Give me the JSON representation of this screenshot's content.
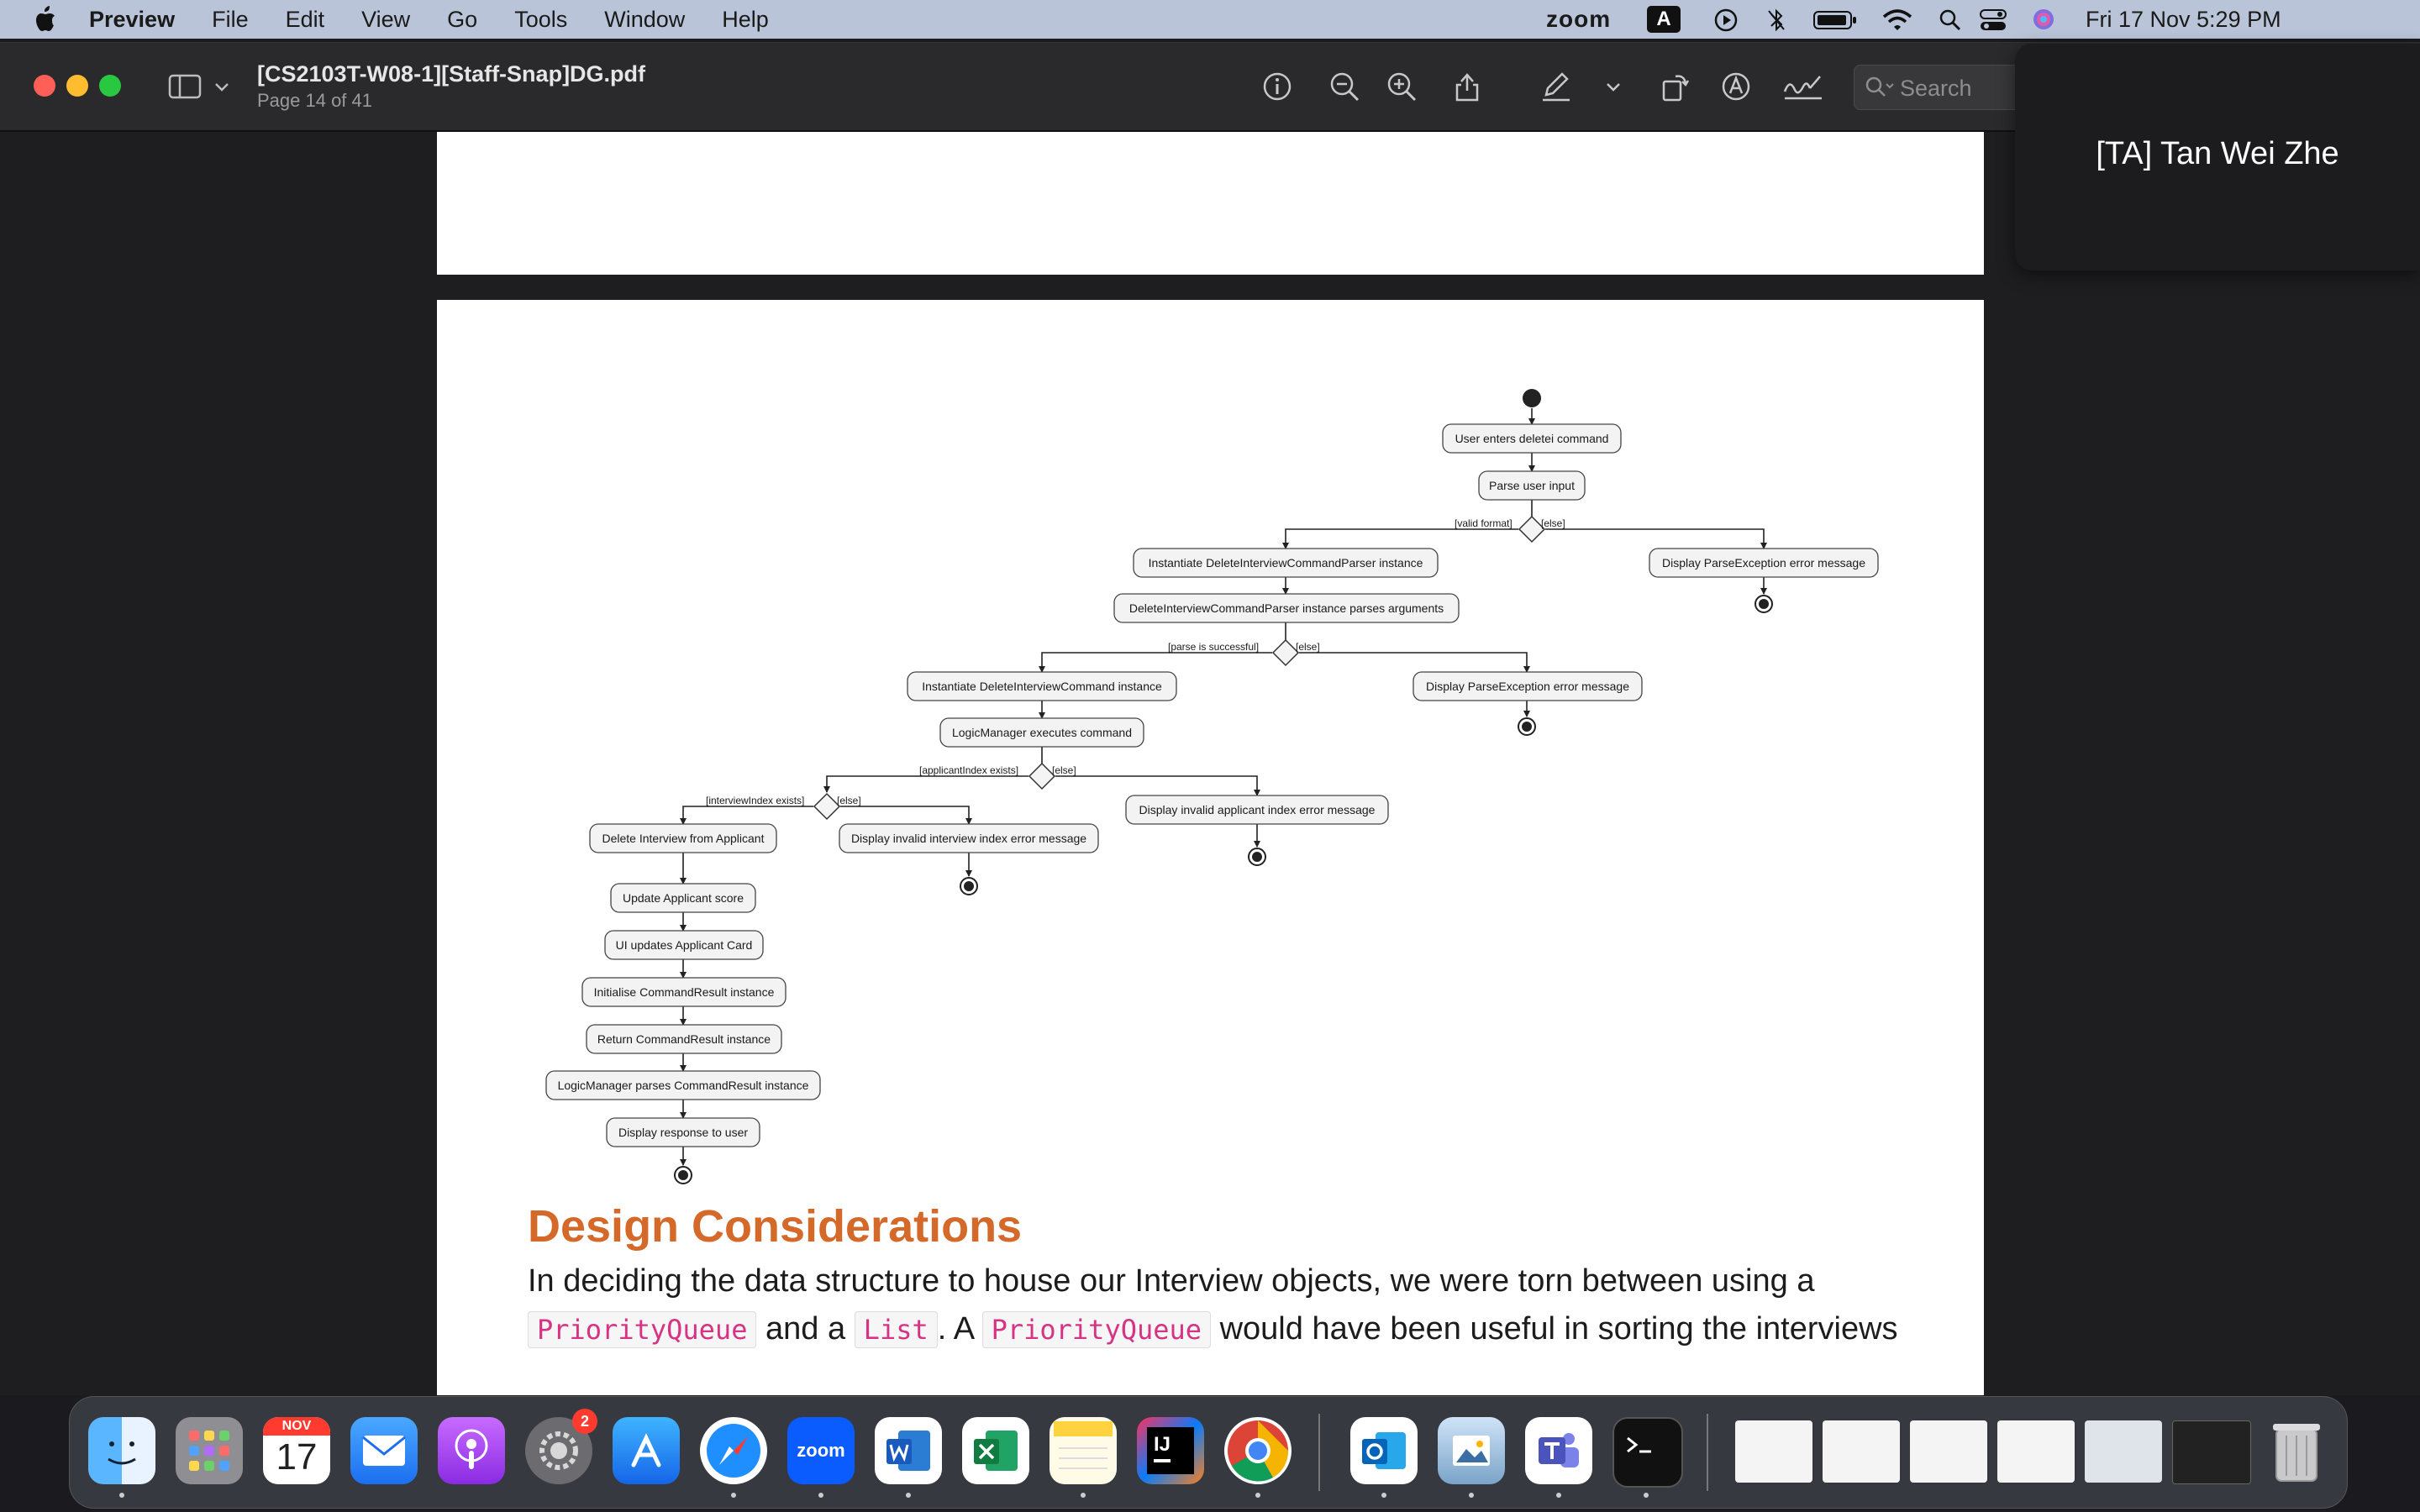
{
  "menubar": {
    "app_name": "Preview",
    "menus": [
      "File",
      "Edit",
      "View",
      "Go",
      "Tools",
      "Window",
      "Help"
    ],
    "zoom_label": "zoom",
    "input_source": "A",
    "clock": "Fri 17 Nov  5:29 PM"
  },
  "window": {
    "title": "[CS2103T-W08-1][Staff-Snap]DG.pdf",
    "subtitle": "Page 14 of 41",
    "search_placeholder": "Search"
  },
  "notification": {
    "text": "[TA] Tan Wei Zhe"
  },
  "diagram": {
    "nodes": {
      "n1": "User enters deletei command",
      "n2": "Parse user input",
      "n3": "Instantiate DeleteInterviewCommandParser instance",
      "n4": "Display ParseException error message",
      "n5": "DeleteInterviewCommandParser instance parses arguments",
      "n6": "Instantiate DeleteInterviewCommand instance",
      "n7": "Display ParseException error message",
      "n8": "LogicManager executes command",
      "n9": "Display invalid applicant index error message",
      "n10": "Delete Interview from Applicant",
      "n11": "Display invalid interview index error message",
      "n12": "Update Applicant score",
      "n13": "UI updates Applicant Card",
      "n14": "Initialise CommandResult instance",
      "n15": "Return CommandResult instance",
      "n16": "LogicManager parses CommandResult instance",
      "n17": "Display response to user"
    },
    "guards": {
      "g1": "[valid format]",
      "g1e": "[else]",
      "g2": "[parse is successful]",
      "g2e": "[else]",
      "g3": "[applicantIndex exists]",
      "g3e": "[else]",
      "g4": "[interviewIndex exists]",
      "g4e": "[else]"
    }
  },
  "doc": {
    "heading": "Design Considerations",
    "para_1": "In deciding the data structure to house our Interview objects, we were torn between using a",
    "code_pq": "PriorityQueue",
    "para_2": "and a",
    "code_list": "List",
    "para_3": ". A",
    "para_4": "would have been useful in sorting the interviews"
  },
  "dock": {
    "calendar_month": "NOV",
    "calendar_day": "17",
    "settings_badge": "2",
    "zoom_label": "zoom"
  }
}
